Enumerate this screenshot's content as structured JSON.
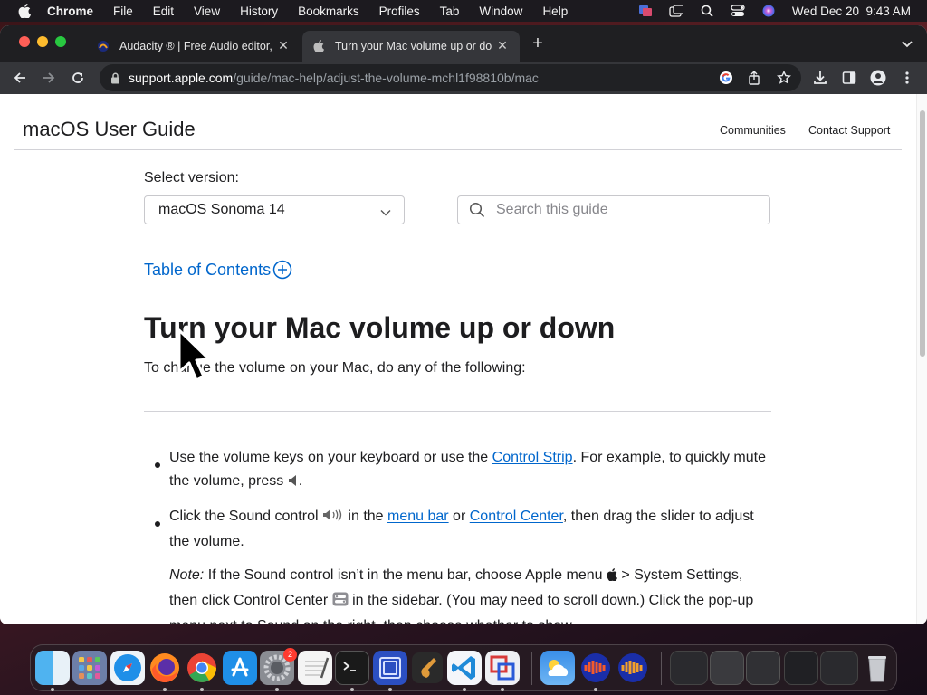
{
  "menubar": {
    "app": "Chrome",
    "items": [
      "File",
      "Edit",
      "View",
      "History",
      "Bookmarks",
      "Profiles",
      "Tab",
      "Window",
      "Help"
    ],
    "datetime": "Wed Dec 20  9:43 AM"
  },
  "tabs": [
    {
      "title": "Audacity ® | Free Audio editor,",
      "active": false
    },
    {
      "title": "Turn your Mac volume up or do",
      "active": true
    }
  ],
  "address": {
    "domain": "support.apple.com",
    "path": "/guide/mac-help/adjust-the-volume-mchl1f98810b/mac"
  },
  "page": {
    "guide_title": "macOS User Guide",
    "nav": [
      "Communities",
      "Contact Support"
    ],
    "version_label": "Select version:",
    "version_value": "macOS Sonoma 14",
    "search_placeholder": "Search this guide",
    "toc_label": "Table of Contents",
    "heading": "Turn your Mac volume up or down",
    "intro": "To change the volume on your Mac, do any of the following:",
    "bullet1": {
      "a": "Use the volume keys on your keyboard or use the ",
      "link": "Control Strip",
      "b": ". For example, to quickly mute the volume, press ",
      "c": "."
    },
    "bullet2": {
      "a": "Click the Sound control ",
      "b": " in the ",
      "link1": "menu bar",
      "c": " or ",
      "link2": "Control Center",
      "d": ", then drag the slider to adjust the volume."
    },
    "note": {
      "label": "Note:",
      "a": " If the Sound control isn’t in the menu bar, choose Apple menu ",
      "b": " > System Settings, then click Control Center ",
      "c": " in the sidebar. (You may need to scroll down.) Click the pop-up menu next to Sound on the right, then choose whether to show"
    }
  },
  "dock": {
    "apps": [
      "finder",
      "launchpad",
      "safari",
      "firefox",
      "chrome",
      "app-store",
      "system-settings",
      "textedit",
      "terminal",
      "screen-sharing",
      "garageband",
      "vscode",
      "parallels",
      "weather",
      "audacity",
      "audacity-2"
    ],
    "settings_badge": "2"
  },
  "colors": {
    "link": "#0066cc",
    "text": "#1d1d1f",
    "toolbar": "#35363a"
  }
}
